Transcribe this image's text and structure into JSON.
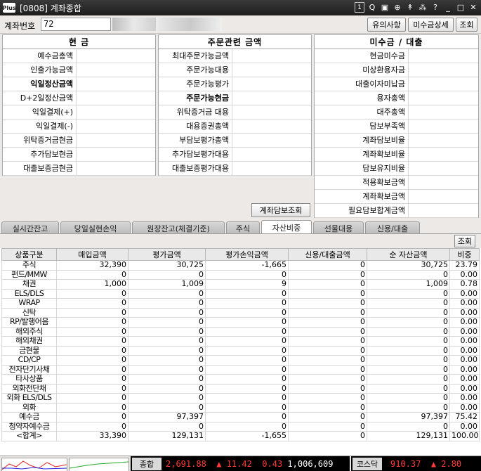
{
  "window": {
    "logo": "Plus",
    "title": "[0808] 계좌종합",
    "icons": [
      "1",
      "Q",
      "▣",
      "⊕",
      "↟",
      "⁂",
      "?"
    ]
  },
  "account": {
    "label": "계좌번호",
    "number": "72",
    "btn_notice": "유의사항",
    "btn_unpaid_detail": "미수금상세",
    "btn_query": "조회"
  },
  "cash_panel": {
    "header": "현   금",
    "rows": [
      "예수금총액",
      "인출가능금액",
      "익일정산금액",
      "D+2일정산금액",
      "익일결제(+)",
      "익일결제(-)",
      "위탁증거금현금",
      "추가담보현금",
      "대출보증금현금"
    ]
  },
  "order_panel": {
    "header": "주문관련 금액",
    "rows": [
      "최대주문가능금액",
      "주문가능대용",
      "주문가능평가",
      "주문가능현금",
      "위탁증거금 대용",
      "대용증권총액",
      "부담보평가총액",
      "추가담보평가대용",
      "대출보증평가대용"
    ]
  },
  "loan_panel": {
    "header": "미수금 / 대출",
    "rows": [
      "현금미수금",
      "미상환용자금",
      "대출이자미납금",
      "용자총액",
      "대주총액",
      "담보부족액",
      "계좌담보비율",
      "계좌확보비율",
      "담보유지비율",
      "적용확보금액",
      "계좌확보금액",
      "필요담보합계금액"
    ]
  },
  "collateral_button": "계좌담보조회",
  "tabs": [
    "실시간잔고",
    "당일실현손익",
    "원장잔고(체결기준)",
    "주식",
    "자산비중",
    "선물대용",
    "신용/대출"
  ],
  "sub_query": "조회",
  "table": {
    "headers": [
      "상품구분",
      "매입금액",
      "평가금액",
      "평가손익금액",
      "신용/대출금액",
      "순 자산금액",
      "비중"
    ],
    "rows": [
      [
        "주식",
        "32,390",
        "30,725",
        "-1,665",
        "0",
        "30,725",
        "23.79"
      ],
      [
        "펀드/MMW",
        "0",
        "0",
        "0",
        "0",
        "0",
        "0.00"
      ],
      [
        "채권",
        "1,000",
        "1,009",
        "9",
        "0",
        "1,009",
        "0.78"
      ],
      [
        "ELS/DLS",
        "0",
        "0",
        "0",
        "0",
        "0",
        "0.00"
      ],
      [
        "WRAP",
        "0",
        "0",
        "0",
        "0",
        "0",
        "0.00"
      ],
      [
        "신탁",
        "0",
        "0",
        "0",
        "0",
        "0",
        "0.00"
      ],
      [
        "RP/발행어음",
        "0",
        "0",
        "0",
        "0",
        "0",
        "0.00"
      ],
      [
        "해외주식",
        "0",
        "0",
        "0",
        "0",
        "0",
        "0.00"
      ],
      [
        "해외채권",
        "0",
        "0",
        "0",
        "0",
        "0",
        "0.00"
      ],
      [
        "금현물",
        "0",
        "0",
        "0",
        "0",
        "0",
        "0.00"
      ],
      [
        "CD/CP",
        "0",
        "0",
        "0",
        "0",
        "0",
        "0.00"
      ],
      [
        "전자단기사채",
        "0",
        "0",
        "0",
        "0",
        "0",
        "0.00"
      ],
      [
        "타사상품",
        "0",
        "0",
        "0",
        "0",
        "0",
        "0.00"
      ],
      [
        "외화전단채",
        "0",
        "0",
        "0",
        "0",
        "0",
        "0.00"
      ],
      [
        "외화 ELS/DLS",
        "0",
        "0",
        "0",
        "0",
        "0",
        "0.00"
      ],
      [
        "외화",
        "0",
        "0",
        "0",
        "0",
        "0",
        "0.00"
      ],
      [
        "예수금",
        "0",
        "97,397",
        "0",
        "0",
        "97,397",
        "75.42"
      ],
      [
        "청약자예수금",
        "0",
        "0",
        "0",
        "0",
        "0",
        "0.00"
      ],
      [
        "<합계>",
        "33,390",
        "129,131",
        "-1,655",
        "0",
        "129,131",
        "100.00"
      ]
    ]
  },
  "status": {
    "kospi_label": "종합",
    "kospi_value": "2,691.88",
    "kospi_change": "▲ 11.42",
    "kospi_pct": "0.43",
    "kospi_volume": "1,006,609",
    "kosdaq_label": "코스닥",
    "kosdaq_value": "910.37",
    "kosdaq_change": "▲ 2.80"
  }
}
